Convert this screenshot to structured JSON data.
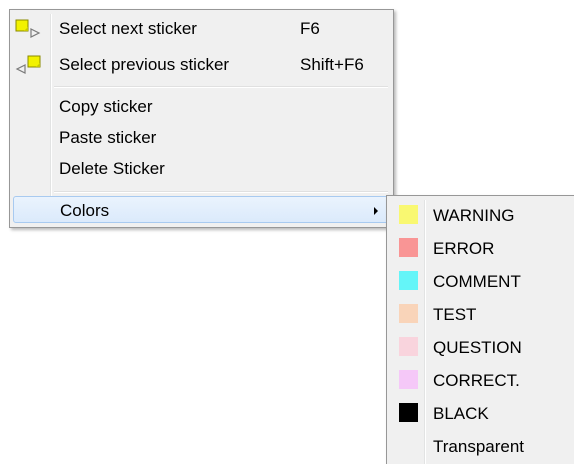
{
  "context_menu": {
    "items": [
      {
        "label": "Select next sticker",
        "shortcut": "F6",
        "icon": "sticker-next-icon"
      },
      {
        "label": "Select previous sticker",
        "shortcut": "Shift+F6",
        "icon": "sticker-previous-icon"
      },
      {
        "label": "Copy sticker",
        "shortcut": ""
      },
      {
        "label": "Paste sticker",
        "shortcut": ""
      },
      {
        "label": "Delete Sticker",
        "shortcut": ""
      },
      {
        "label": "Colors",
        "shortcut": "",
        "has_submenu": true,
        "highlighted": true
      }
    ]
  },
  "colors_submenu": {
    "items": [
      {
        "label": "WARNING",
        "color": "#f9f871"
      },
      {
        "label": "ERROR",
        "color": "#f99595"
      },
      {
        "label": "COMMENT",
        "color": "#64f5f8"
      },
      {
        "label": "TEST",
        "color": "#f9d4b9"
      },
      {
        "label": "QUESTION",
        "color": "#f9d4dd"
      },
      {
        "label": "CORRECT.",
        "color": "#f5c8f8"
      },
      {
        "label": "BLACK",
        "color": "#000000"
      },
      {
        "label": "Transparent",
        "color": ""
      }
    ]
  },
  "theme": {
    "menu_background": "#f0f0f0",
    "highlight_border": "#a8caf0",
    "sticker_yellow": "#f2f200"
  }
}
